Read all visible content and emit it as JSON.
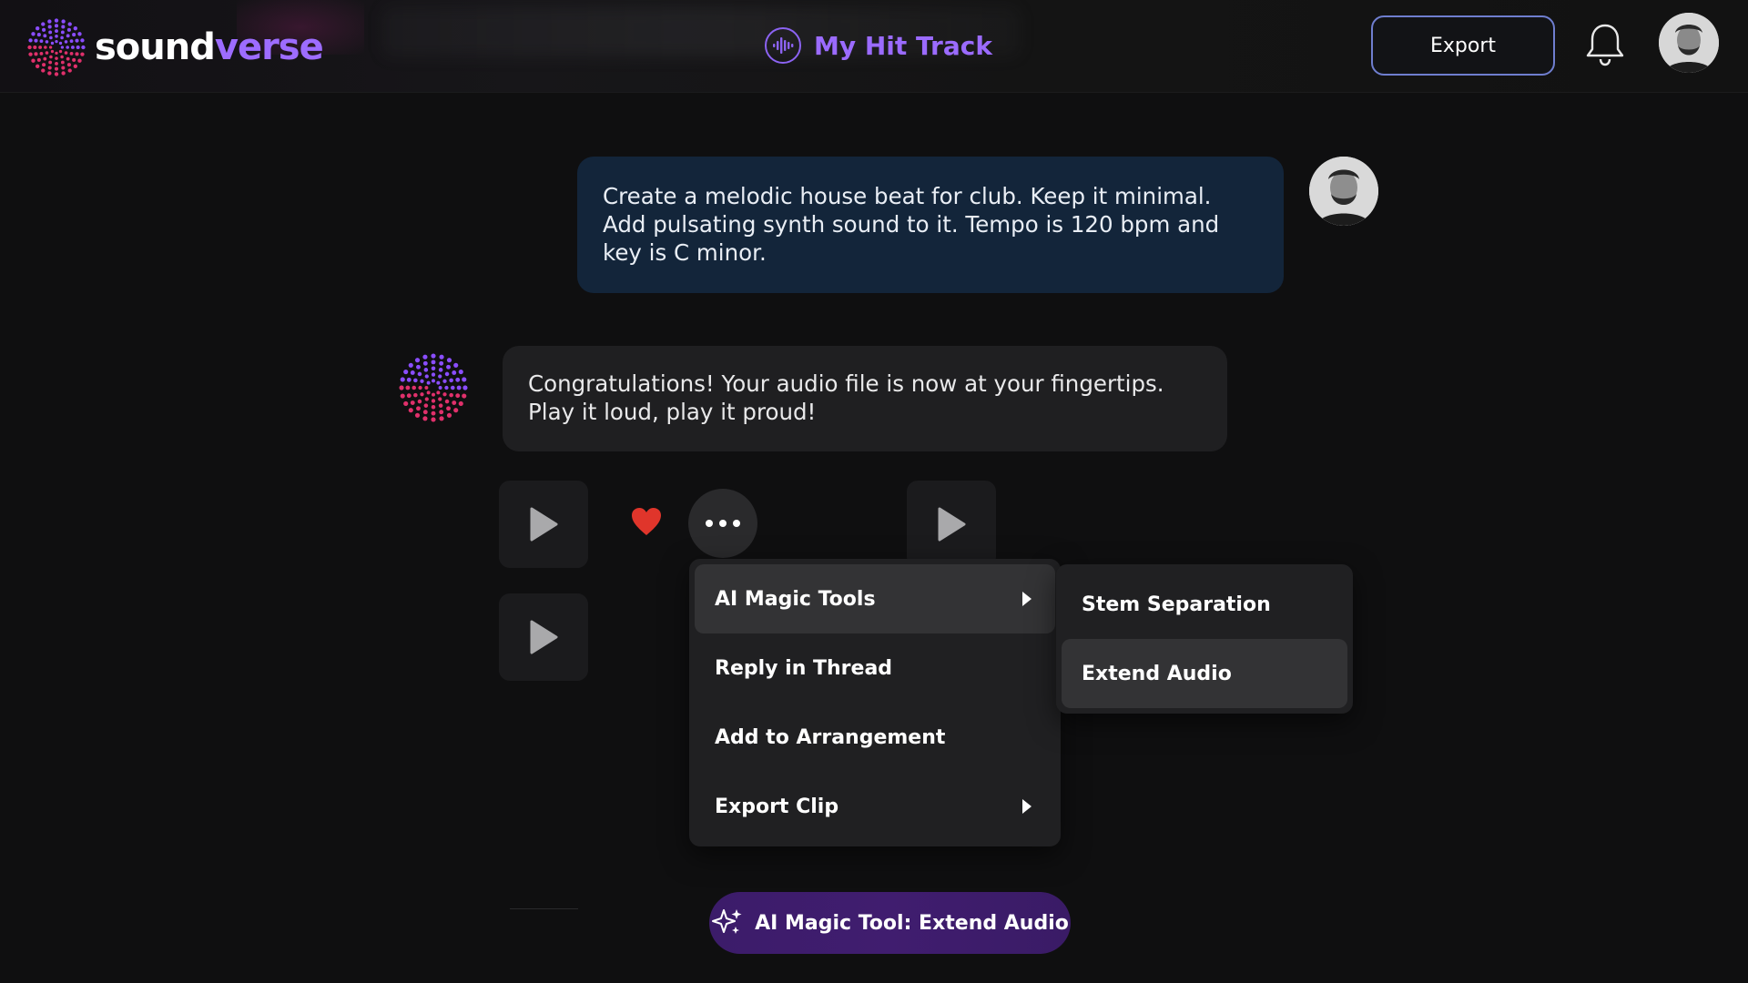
{
  "header": {
    "logo_part1": "sound",
    "logo_part2": "verse",
    "project_title": "My Hit Track",
    "export_label": "Export"
  },
  "chat": {
    "user_message": "Create a melodic house beat for club. Keep it minimal. Add pulsating synth sound to it. Tempo is 120 bpm and key is C minor.",
    "bot_message": "Congratulations! Your audio file is now at your fingertips. Play it loud, play it proud!"
  },
  "menu": {
    "items": [
      {
        "label": "AI Magic Tools",
        "has_submenu": true,
        "active": true
      },
      {
        "label": "Reply in Thread",
        "has_submenu": false
      },
      {
        "label": "Add to Arrangement",
        "has_submenu": false
      },
      {
        "label": "Export Clip",
        "has_submenu": true
      }
    ]
  },
  "submenu": {
    "items": [
      {
        "label": "Stem Separation"
      },
      {
        "label": "Extend Audio",
        "active": true
      }
    ]
  },
  "magic_tool_pill": "AI Magic Tool: Extend Audio",
  "colors": {
    "accent_purple": "#9b6bff",
    "export_border": "#6f7ecf",
    "user_bubble": "#13253a",
    "heart": "#e0352b"
  },
  "icons": [
    "soundverse-logo-icon",
    "waveform-icon",
    "bell-icon",
    "play-icon",
    "heart-icon",
    "more-icon",
    "sparkle-icon"
  ]
}
